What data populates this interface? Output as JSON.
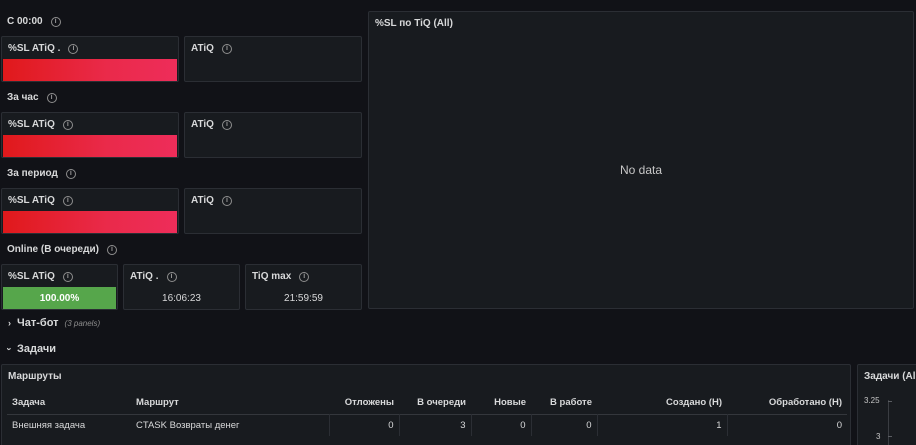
{
  "sections": {
    "since_midnight": "С 00:00",
    "per_hour": "За час",
    "per_period": "За период",
    "online": "Online (В очереди)"
  },
  "stats": {
    "sl_atiq_dot": "%SL ATiQ .",
    "atiq": "ATiQ",
    "sl_atiq": "%SL ATiQ",
    "atiq_dot": "ATiQ .",
    "tiq_max": "TiQ max",
    "online_sl_value": "100.00%",
    "online_sl_fraction": 1.0,
    "online_atiq_value": "16:06:23",
    "online_tiq_max_value": "21:59:59"
  },
  "chart_panel": {
    "title": "%SL по TiQ (All)",
    "empty": "No data"
  },
  "rows": {
    "chatbot": {
      "title": "Чат-бот",
      "sub": "(3 panels)"
    },
    "tasks": {
      "title": "Задачи"
    }
  },
  "routes_table": {
    "title": "Маршруты",
    "headers": [
      "Задача",
      "Маршрут",
      "Отложены",
      "В очереди",
      "Новые",
      "В работе",
      "Создано (H)",
      "Обработано (H)"
    ],
    "rows": [
      [
        "Внешняя задача",
        "CTASK Возвраты денег",
        "0",
        "3",
        "0",
        "0",
        "1",
        "0"
      ]
    ]
  },
  "tasks_panel": {
    "title": "Задачи (All",
    "y_ticks": [
      "3.25",
      "3"
    ]
  },
  "colors": {
    "background": "#111217",
    "panel": "#181b1f",
    "red": "#e0191b",
    "pink": "#ee2d5a",
    "green": "#56a64b"
  }
}
